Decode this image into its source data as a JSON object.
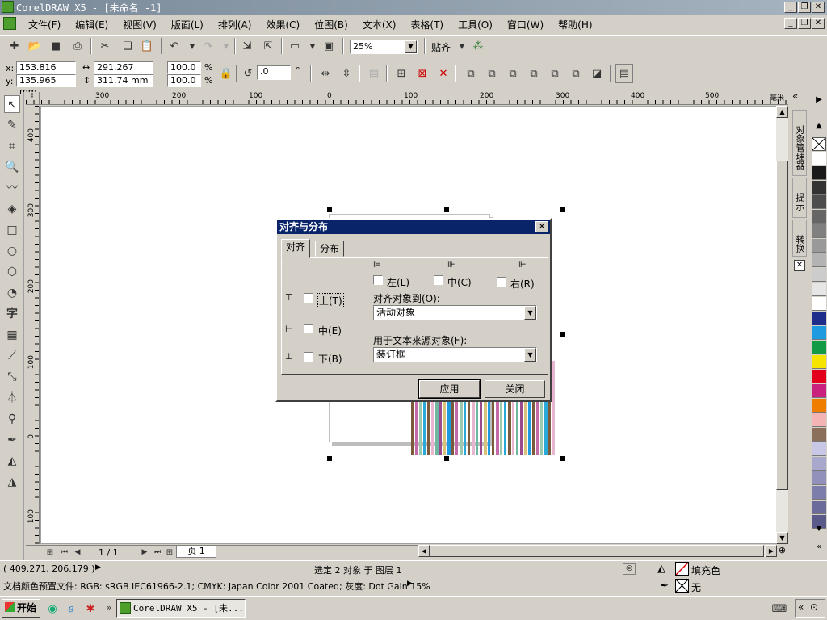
{
  "window": {
    "title": "CorelDRAW X5 - [未命名 -1]"
  },
  "menu": [
    "文件(F)",
    "编辑(E)",
    "视图(V)",
    "版面(L)",
    "排列(A)",
    "效果(C)",
    "位图(B)",
    "文本(X)",
    "表格(T)",
    "工具(O)",
    "窗口(W)",
    "帮助(H)"
  ],
  "toolbar": {
    "zoom": "25%",
    "snap_label": "贴齐"
  },
  "propbar": {
    "x_label": "x:",
    "x_value": "153.816 mm",
    "y_label": "y:",
    "y_value": "135.965 mm",
    "w_value": "291.267 mm",
    "h_value": "311.74 mm",
    "scale_x": "100.0",
    "scale_y": "100.0",
    "pct": "%",
    "rotation": ".0",
    "deg": "°"
  },
  "ruler": {
    "unit": "毫米",
    "h_ticks": [
      "300",
      "200",
      "100",
      "0",
      "100",
      "200",
      "300",
      "400",
      "500"
    ],
    "v_ticks": [
      "400",
      "300",
      "200",
      "100",
      "0",
      "100"
    ]
  },
  "dialog": {
    "title": "对齐与分布",
    "tabs": [
      "对齐",
      "分布"
    ],
    "left": "左(L)",
    "center_h": "中(C)",
    "right": "右(R)",
    "top": "上(T)",
    "center_v": "中(E)",
    "bottom": "下(B)",
    "align_to_label": "对齐对象到(O):",
    "align_to_value": "活动对象",
    "text_source_label": "用于文本来源对象(F):",
    "text_source_value": "装订框",
    "apply": "应用",
    "close": "关闭"
  },
  "pagenav": {
    "page_count": "1 / 1",
    "page_tab": "页 1"
  },
  "status": {
    "coords": "( 409.271, 206.179 )",
    "selection": "选定 2 对象 于 图层 1",
    "profile": "文档颜色预置文件: RGB: sRGB IEC61966-2.1; CMYK: Japan Color 2001 Coated; 灰度: Dot Gain 15%",
    "fill": "填充色",
    "outline": "无"
  },
  "dockers": [
    "对象管理器",
    "提示",
    "转换"
  ],
  "taskbar": {
    "start": "开始",
    "item": "CorelDRAW X5 - [未..."
  },
  "palette_colors": [
    "#ffffff",
    "#1a1a1a",
    "#333333",
    "#4d4d4d",
    "#666666",
    "#808080",
    "#999999",
    "#b3b3b3",
    "#cccccc",
    "#e6e6e6",
    "#ffffff",
    "#1f2d8a",
    "#1e9be0",
    "#129a44",
    "#f5e400",
    "#e3001b",
    "#c9227e",
    "#ef7d00",
    "#f4b4b4",
    "#8b6f5b",
    "#c8c8e6",
    "#a8a8cc",
    "#9191bb",
    "#7d7dab",
    "#6b6b9b",
    "#5a5a8a"
  ],
  "stripe_colors": [
    "#7a5a3a",
    "#c56aa8",
    "#9cc9b0",
    "#2aa8d8",
    "#7a5a3a",
    "#e8b4d0",
    "#6fb7a0",
    "#9b4a8c",
    "#d9c27a",
    "#1e9be0"
  ]
}
